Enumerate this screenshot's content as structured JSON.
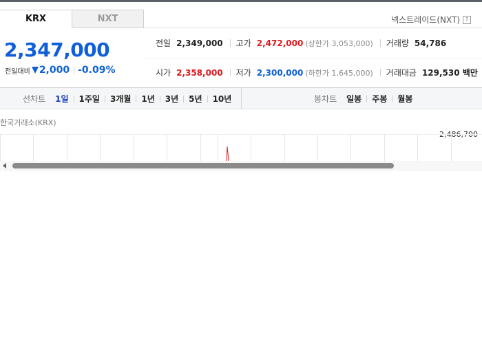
{
  "tabs": {
    "krx": "KRX",
    "nxt": "NXT"
  },
  "nxt_link": {
    "label": "넥스트레이드(NXT)",
    "icon": "external-link-icon"
  },
  "price": {
    "current": "2,347,000",
    "change_label": "전일대비",
    "change_value": "2,000",
    "change_rate": "-0.09%",
    "direction": "down"
  },
  "stats": {
    "prev_close": {
      "label": "전일",
      "value": "2,349,000"
    },
    "high": {
      "label": "고가",
      "value": "2,472,000",
      "note": "(상한가 3,053,000)"
    },
    "volume": {
      "label": "거래량",
      "value": "54,786"
    },
    "open": {
      "label": "시가",
      "value": "2,358,000"
    },
    "low": {
      "label": "저가",
      "value": "2,300,000",
      "note": "(하한가 1,645,000)"
    },
    "amount": {
      "label": "거래대금",
      "value": "129,530 백만"
    }
  },
  "chart_controls": {
    "line_title": "선차트",
    "line_periods": [
      "1일",
      "1주일",
      "3개월",
      "1년",
      "3년",
      "5년",
      "10년"
    ],
    "active_period": "1일",
    "candle_title": "봉차트",
    "candle_periods": [
      "일봉",
      "주봉",
      "월봉"
    ]
  },
  "chart": {
    "source": "한국거래소(KRX)",
    "y_label": "2,486,700"
  },
  "colors": {
    "up": "#e0191e",
    "down": "#0e5fd8",
    "active": "#1a3cbf"
  }
}
